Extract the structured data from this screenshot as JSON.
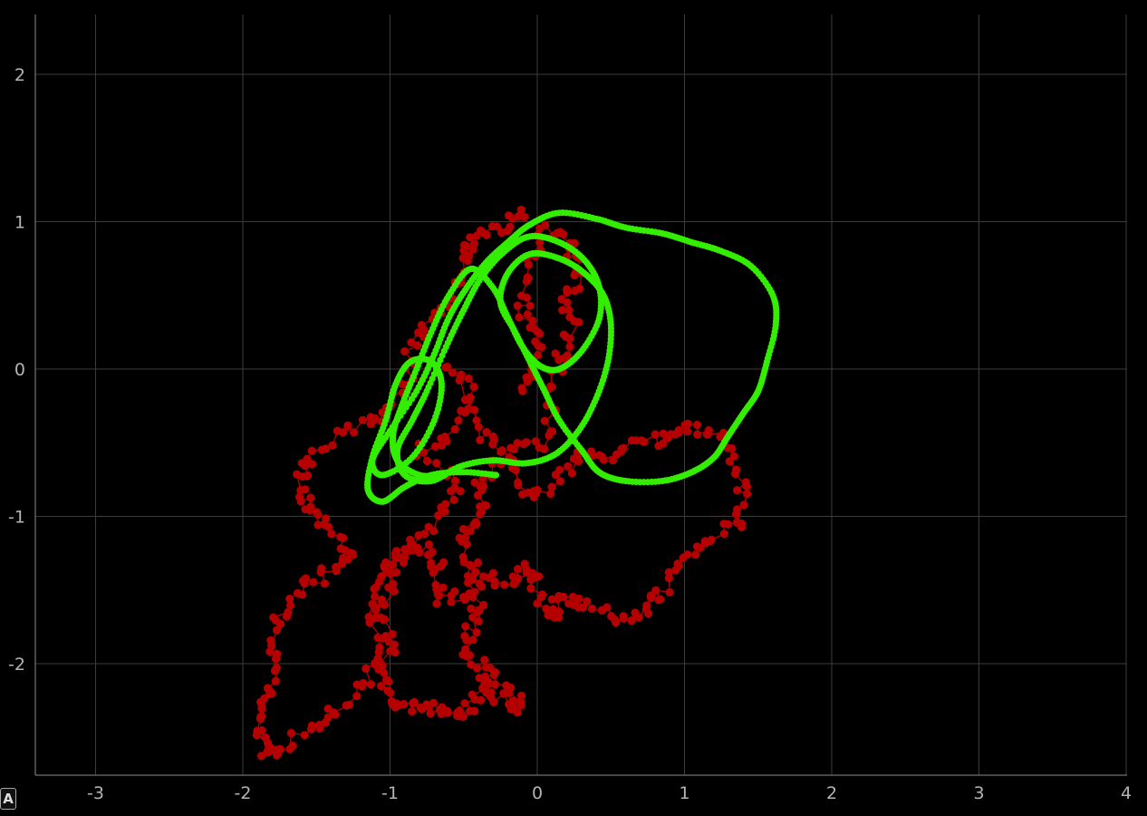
{
  "auto_button_label": "A",
  "chart_data": {
    "type": "scatter",
    "title": "",
    "xlabel": "",
    "ylabel": "",
    "xlim": [
      -3.4,
      4
    ],
    "ylim": [
      -2.75,
      2.4
    ],
    "grid": true,
    "x_ticks": [
      -3,
      -2,
      -1,
      0,
      1,
      2,
      3,
      4
    ],
    "y_ticks": [
      2,
      1,
      0,
      -1,
      -2
    ],
    "colors": {
      "background": "#000000",
      "grid": "#3c3c3c",
      "axis": "#8c8c8c",
      "series_red": "#b40000",
      "series_green": "#33ee00"
    },
    "series": [
      {
        "color": "#b40000",
        "mode": "lines+markers",
        "anchors": [
          [
            -0.1,
            1.05
          ],
          [
            -0.25,
            0.95
          ],
          [
            -0.45,
            0.9
          ],
          [
            -0.5,
            0.75
          ],
          [
            -0.55,
            0.55
          ],
          [
            -0.7,
            0.35
          ],
          [
            -0.85,
            0.15
          ],
          [
            -0.9,
            -0.15
          ],
          [
            -1.05,
            -0.35
          ],
          [
            -1.3,
            -0.4
          ],
          [
            -1.55,
            -0.6
          ],
          [
            -1.6,
            -0.75
          ],
          [
            -1.55,
            -0.95
          ],
          [
            -1.4,
            -1.1
          ],
          [
            -1.25,
            -1.25
          ],
          [
            -1.4,
            -1.35
          ],
          [
            -1.6,
            -1.5
          ],
          [
            -1.75,
            -1.7
          ],
          [
            -1.8,
            -1.95
          ],
          [
            -1.8,
            -2.2
          ],
          [
            -1.9,
            -2.35
          ],
          [
            -1.85,
            -2.6
          ],
          [
            -1.75,
            -2.6
          ],
          [
            -1.55,
            -2.45
          ],
          [
            -1.35,
            -2.3
          ],
          [
            -1.15,
            -2.1
          ],
          [
            -0.95,
            -1.85
          ],
          [
            -1.1,
            -1.65
          ],
          [
            -1.05,
            -1.4
          ],
          [
            -0.85,
            -1.2
          ],
          [
            -0.65,
            -1.0
          ],
          [
            -0.55,
            -0.8
          ],
          [
            -0.8,
            -0.55
          ],
          [
            -0.6,
            -0.45
          ],
          [
            -0.45,
            -0.15
          ],
          [
            -0.6,
            0.05
          ],
          [
            -0.35,
            -0.45
          ],
          [
            -0.2,
            -0.6
          ],
          [
            -0.05,
            -0.9
          ],
          [
            0.15,
            -0.75
          ],
          [
            0.3,
            -0.55
          ],
          [
            0.5,
            -0.6
          ],
          [
            0.7,
            -0.5
          ],
          [
            0.9,
            -0.45
          ],
          [
            1.05,
            -0.4
          ],
          [
            1.3,
            -0.5
          ],
          [
            1.4,
            -0.8
          ],
          [
            1.35,
            -1.05
          ],
          [
            1.15,
            -1.15
          ],
          [
            0.95,
            -1.3
          ],
          [
            0.85,
            -1.5
          ],
          [
            0.75,
            -1.65
          ],
          [
            0.55,
            -1.7
          ],
          [
            0.35,
            -1.6
          ],
          [
            0.15,
            -1.55
          ],
          [
            0.1,
            -1.7
          ],
          [
            0.0,
            -1.45
          ],
          [
            -0.05,
            -1.35
          ],
          [
            -0.2,
            -1.45
          ],
          [
            -0.4,
            -1.4
          ],
          [
            -0.5,
            -1.55
          ],
          [
            -0.7,
            -1.55
          ],
          [
            -0.65,
            -1.35
          ],
          [
            -0.75,
            -1.2
          ],
          [
            -0.9,
            -1.25
          ],
          [
            -1.05,
            -1.3
          ],
          [
            -1.0,
            -1.5
          ],
          [
            -1.1,
            -1.75
          ],
          [
            -1.05,
            -2.05
          ],
          [
            -1.0,
            -2.25
          ],
          [
            -0.85,
            -2.3
          ],
          [
            -0.7,
            -2.3
          ],
          [
            -0.55,
            -2.35
          ],
          [
            -0.45,
            -2.3
          ],
          [
            -0.35,
            -2.1
          ],
          [
            -0.3,
            -2.2
          ],
          [
            -0.15,
            -2.3
          ],
          [
            -0.15,
            -2.25
          ],
          [
            -0.3,
            -2.05
          ],
          [
            -0.5,
            -1.95
          ],
          [
            -0.45,
            -1.75
          ],
          [
            -0.4,
            -1.55
          ],
          [
            -0.45,
            -1.3
          ],
          [
            -0.5,
            -1.1
          ],
          [
            -0.35,
            -0.95
          ],
          [
            -0.4,
            -0.75
          ],
          [
            -0.2,
            -0.55
          ],
          [
            0.05,
            -0.5
          ],
          [
            0.1,
            -0.25
          ],
          [
            0.15,
            0.05
          ],
          [
            0.25,
            0.25
          ],
          [
            0.2,
            0.5
          ],
          [
            0.3,
            0.65
          ],
          [
            0.2,
            0.85
          ],
          [
            0.05,
            0.95
          ],
          [
            -0.05,
            0.7
          ],
          [
            -0.1,
            0.4
          ],
          [
            0.0,
            0.25
          ],
          [
            -0.05,
            0.0
          ],
          [
            -0.1,
            -0.15
          ]
        ]
      },
      {
        "color": "#33ee00",
        "mode": "markers",
        "anchors": [
          [
            -0.28,
            -0.72
          ],
          [
            -0.5,
            -0.7
          ],
          [
            -0.72,
            -0.72
          ],
          [
            -0.9,
            -0.8
          ],
          [
            -1.05,
            -0.9
          ],
          [
            -1.15,
            -0.82
          ],
          [
            -1.12,
            -0.6
          ],
          [
            -1.03,
            -0.35
          ],
          [
            -0.96,
            -0.1
          ],
          [
            -0.86,
            0.05
          ],
          [
            -0.72,
            0.05
          ],
          [
            -0.65,
            -0.1
          ],
          [
            -0.7,
            -0.35
          ],
          [
            -0.85,
            -0.6
          ],
          [
            -1.05,
            -0.72
          ],
          [
            -1.12,
            -0.62
          ],
          [
            -1.0,
            -0.42
          ],
          [
            -0.82,
            -0.15
          ],
          [
            -0.7,
            0.1
          ],
          [
            -0.6,
            0.35
          ],
          [
            -0.48,
            0.55
          ],
          [
            -0.35,
            0.72
          ],
          [
            -0.2,
            0.86
          ],
          [
            -0.05,
            0.98
          ],
          [
            0.15,
            1.06
          ],
          [
            0.4,
            1.02
          ],
          [
            0.6,
            0.96
          ],
          [
            0.85,
            0.92
          ],
          [
            1.05,
            0.86
          ],
          [
            1.25,
            0.8
          ],
          [
            1.45,
            0.7
          ],
          [
            1.6,
            0.5
          ],
          [
            1.62,
            0.3
          ],
          [
            1.56,
            0.05
          ],
          [
            1.5,
            -0.15
          ],
          [
            1.4,
            -0.3
          ],
          [
            1.3,
            -0.45
          ],
          [
            1.2,
            -0.6
          ],
          [
            1.05,
            -0.7
          ],
          [
            0.85,
            -0.76
          ],
          [
            0.6,
            -0.76
          ],
          [
            0.42,
            -0.7
          ],
          [
            0.3,
            -0.55
          ],
          [
            0.15,
            -0.35
          ],
          [
            0.05,
            -0.15
          ],
          [
            -0.05,
            0.05
          ],
          [
            -0.15,
            0.25
          ],
          [
            -0.25,
            0.45
          ],
          [
            -0.2,
            0.65
          ],
          [
            -0.05,
            0.78
          ],
          [
            0.15,
            0.75
          ],
          [
            0.32,
            0.65
          ],
          [
            0.45,
            0.5
          ],
          [
            0.5,
            0.3
          ],
          [
            0.48,
            0.05
          ],
          [
            0.4,
            -0.2
          ],
          [
            0.28,
            -0.42
          ],
          [
            0.12,
            -0.58
          ],
          [
            -0.08,
            -0.64
          ],
          [
            -0.3,
            -0.62
          ],
          [
            -0.52,
            -0.66
          ],
          [
            -0.72,
            -0.76
          ],
          [
            -0.9,
            -0.72
          ],
          [
            -0.95,
            -0.55
          ],
          [
            -0.85,
            -0.35
          ],
          [
            -0.75,
            -0.15
          ],
          [
            -0.62,
            0.15
          ],
          [
            -0.5,
            0.4
          ],
          [
            -0.38,
            0.62
          ],
          [
            -0.22,
            0.8
          ],
          [
            -0.05,
            0.9
          ],
          [
            0.15,
            0.86
          ],
          [
            0.32,
            0.74
          ],
          [
            0.42,
            0.56
          ],
          [
            0.42,
            0.34
          ],
          [
            0.3,
            0.12
          ],
          [
            0.15,
            0.0
          ],
          [
            0.02,
            0.02
          ],
          [
            -0.1,
            0.15
          ],
          [
            -0.2,
            0.35
          ],
          [
            -0.3,
            0.55
          ],
          [
            -0.45,
            0.68
          ],
          [
            -0.6,
            0.5
          ],
          [
            -0.72,
            0.25
          ],
          [
            -0.82,
            0.0
          ],
          [
            -0.92,
            -0.25
          ],
          [
            -0.98,
            -0.45
          ],
          [
            -0.95,
            -0.62
          ],
          [
            -0.8,
            -0.72
          ],
          [
            -0.62,
            -0.72
          ]
        ]
      }
    ]
  }
}
